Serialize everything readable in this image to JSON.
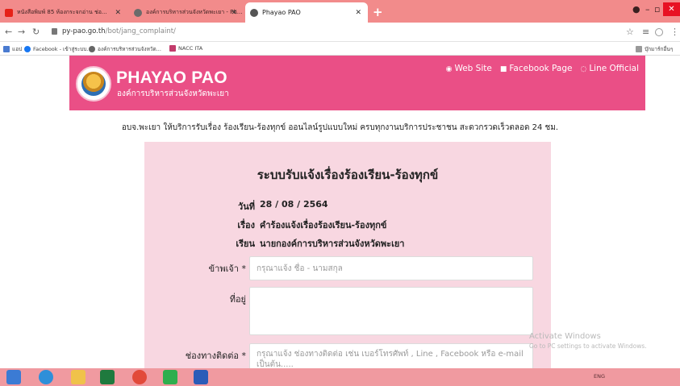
{
  "browser": {
    "tabs": [
      {
        "title": "หนังสือพิมพ์ 85 ห้องกระจกอ่าน ช่อ...",
        "active": false
      },
      {
        "title": "องค์การบริหารส่วนจังหวัดพะเยา - Ph...",
        "active": false
      },
      {
        "title": "Phayao PAO",
        "active": true
      }
    ],
    "url_domain": "py-pao.go.th",
    "url_path": "/bot/jang_complaint/",
    "bookmarks": [
      "แอป",
      "Facebook - เข้าสู่ระบบ...",
      "องค์การบริหารส่วนจังหวัด...",
      "NACC ITA"
    ],
    "other_bookmarks": "บุ๊กมาร์กอื่นๆ"
  },
  "header": {
    "brand": "PHAYAO PAO",
    "brand_sub": "องค์การบริหารส่วนจังหวัดพะเยา",
    "links": [
      {
        "icon": "globe-icon",
        "label": "Web Site"
      },
      {
        "icon": "facebook-icon",
        "label": "Facebook Page"
      },
      {
        "icon": "chat-icon",
        "label": "Line Official"
      }
    ]
  },
  "notice": "อบจ.พะเยา ให้บริการรับเรื่อง ร้องเรียน-ร้องทุกข์ ออนไลน์รูปแบบใหม่ ครบทุกงานบริการประชาชน สะดวกรวดเร็วตลอด 24 ชม.",
  "form": {
    "title": "ระบบรับแจ้งเรื่องร้องเรียน-ร้องทุกข์",
    "date_label": "วันที่",
    "date_value": "28 / 08 / 2564",
    "subject_label": "เรื่อง",
    "subject_value": "คำร้องแจ้งเรื่องร้องเรียน-ร้องทุกข์",
    "to_label": "เรียน",
    "to_value": "นายกองค์การบริหารส่วนจังหวัดพะเยา",
    "name_label": "ข้าพเจ้า",
    "name_placeholder": "กรุณาแจ้ง ชื่อ - นามสกุล",
    "address_label": "ที่อยู่",
    "address_value": "",
    "contact_label": "ช่องทางติดต่อ",
    "contact_placeholder": "กรุณาแจ้ง ช่องทางติดต่อ เช่น เบอร์โทรศัพท์ , Line , Facebook หรือ e-mail เป็นต้น.....",
    "required_mark": "*"
  },
  "watermark": {
    "title": "Activate Windows",
    "subtitle": "Go to PC settings to activate Windows."
  },
  "taskbar": {
    "tray_text": "ENG"
  }
}
